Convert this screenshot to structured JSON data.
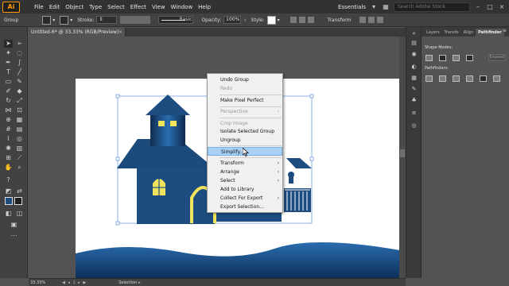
{
  "app": {
    "logo": "Ai"
  },
  "menubar": {
    "items": [
      "File",
      "Edit",
      "Object",
      "Type",
      "Select",
      "Effect",
      "View",
      "Window",
      "Help"
    ],
    "workspace": "Essentials",
    "search_placeholder": "Search Adobe Stock"
  },
  "controlbar": {
    "selection_label": "Group",
    "stroke_label": "Stroke:",
    "brush_label": "Basic",
    "opacity_label": "Opacity:",
    "opacity_value": "100%",
    "style_label": "Style:",
    "transform_label": "Transform"
  },
  "document": {
    "tab_title": "Untitled-6* @ 33.33% (RGB/Preview)",
    "close": "×"
  },
  "panel": {
    "tabs": [
      "Layers",
      "Transfo",
      "Align",
      "Pathfinder"
    ],
    "active_tab": "Pathfinder",
    "shape_modes_label": "Shape Modes:",
    "pathfinders_label": "Pathfinders:",
    "expand_label": "Expand"
  },
  "statusbar": {
    "zoom": "33.33%",
    "tool": "Selection"
  },
  "context_menu": {
    "items": [
      {
        "label": "Undo Group",
        "enabled": true
      },
      {
        "label": "Redo",
        "enabled": false
      },
      {
        "label": "Make Pixel Perfect",
        "enabled": true
      },
      {
        "label": "Perspective",
        "enabled": false
      },
      {
        "label": "Crop Image",
        "enabled": false
      },
      {
        "label": "Isolate Selected Group",
        "enabled": true
      },
      {
        "label": "Ungroup",
        "enabled": true
      },
      {
        "label": "Simplify...",
        "enabled": true,
        "highlighted": true
      },
      {
        "label": "Transform",
        "enabled": true
      },
      {
        "label": "Arrange",
        "enabled": true
      },
      {
        "label": "Select",
        "enabled": true
      },
      {
        "label": "Add to Library",
        "enabled": true
      },
      {
        "label": "Collect For Export",
        "enabled": true
      },
      {
        "label": "Export Selection...",
        "enabled": true
      }
    ]
  },
  "colors": {
    "house_blue": "#1d4d80",
    "house_dark": "#13365c",
    "window_yellow": "#f1e35c",
    "menu_highlight": "#a9d1f7",
    "selection_blue": "#5b8fd6"
  }
}
